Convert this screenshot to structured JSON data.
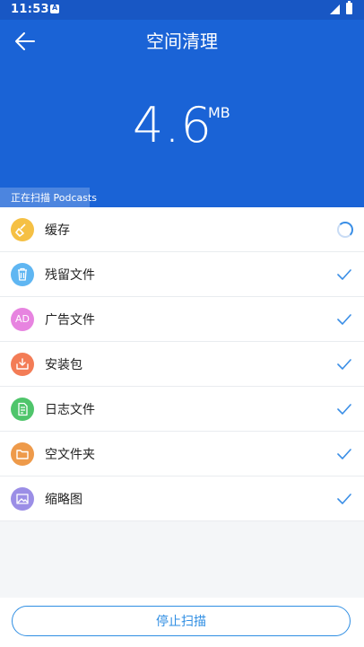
{
  "status_bar": {
    "time": "11:53",
    "notification_icon": "A"
  },
  "header": {
    "title": "空间清理",
    "size_value": "4.6",
    "size_unit": "MB",
    "scan_text": "正在扫描 Podcasts"
  },
  "items": [
    {
      "label": "缓存",
      "icon": "broom-icon",
      "color": "#f5c044",
      "state": "scanning"
    },
    {
      "label": "残留文件",
      "icon": "trash-icon",
      "color": "#5fb6f2",
      "state": "done"
    },
    {
      "label": "广告文件",
      "icon": "ad-icon",
      "color": "#e784e0",
      "icon_text": "AD",
      "state": "done"
    },
    {
      "label": "安装包",
      "icon": "package-icon",
      "color": "#f37c56",
      "state": "done"
    },
    {
      "label": "日志文件",
      "icon": "document-icon",
      "color": "#4fc56b",
      "state": "done"
    },
    {
      "label": "空文件夹",
      "icon": "folder-icon",
      "color": "#ee9a4a",
      "state": "done"
    },
    {
      "label": "缩略图",
      "icon": "image-icon",
      "color": "#9b8ee6",
      "state": "done"
    }
  ],
  "footer": {
    "stop_label": "停止扫描"
  },
  "colors": {
    "header": "#1a63d6",
    "accent": "#2f8ee3",
    "check": "#3a8ee6"
  }
}
